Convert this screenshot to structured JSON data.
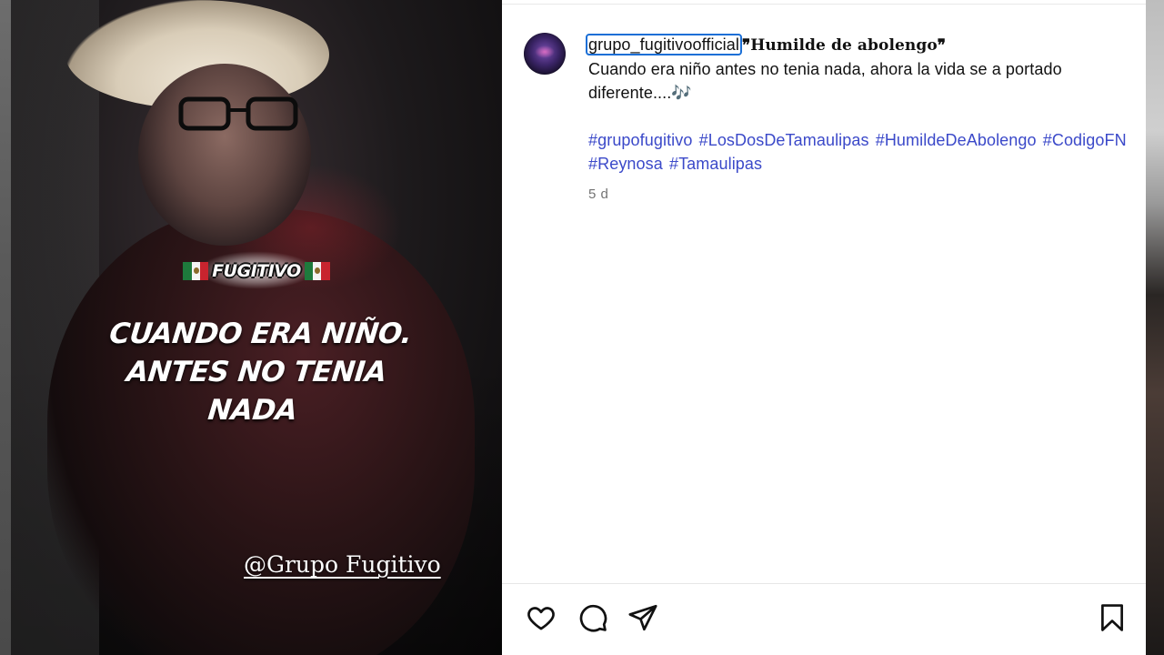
{
  "media": {
    "brand_text": "FUGITIVO",
    "overlay_lines": [
      "CUANDO ERA NIÑO.",
      "ANTES NO TENIA",
      "NADA"
    ],
    "watermark_handle": "@Grupo Fugitivo"
  },
  "post": {
    "username": "grupo_fugitivoofficial",
    "song_title": "❞Humilde de abolengo❞",
    "caption_text": "Cuando era niño antes no tenia nada, ahora la vida se a portado diferente....🎶",
    "hashtags": [
      "#grupofugitivo",
      "#LosDosDeTamaulipas",
      "#HumildeDeAbolengo",
      "#CodigoFN",
      "#Reynosa",
      "#Tamaulipas"
    ],
    "timestamp": "5 d"
  },
  "actions": {
    "icons": [
      "heart-icon",
      "comment-icon",
      "share-icon",
      "bookmark-icon"
    ]
  }
}
